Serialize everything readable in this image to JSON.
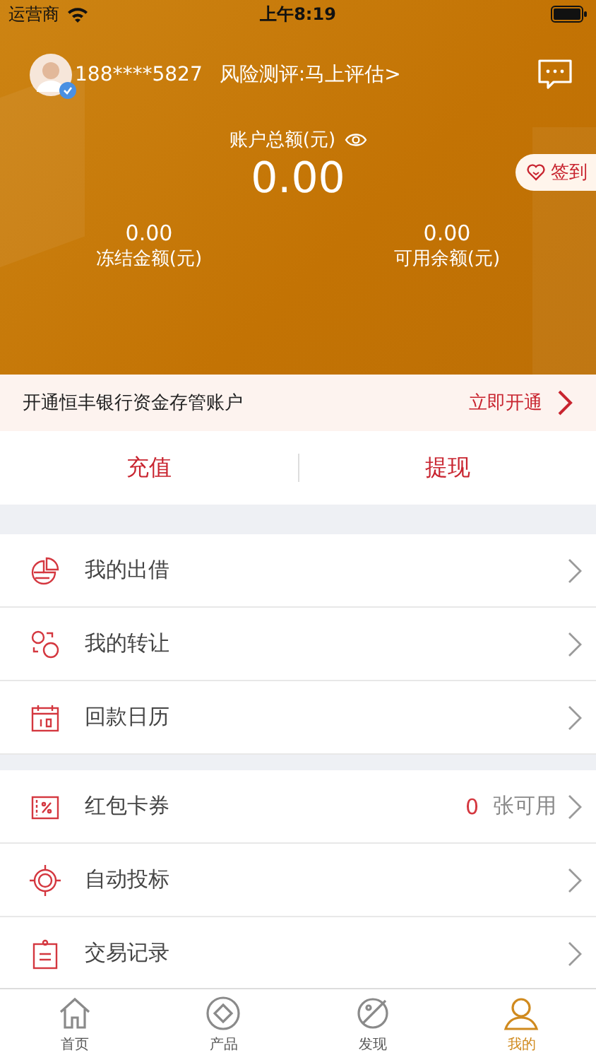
{
  "status_bar": {
    "carrier": "运营商",
    "time": "上午8:19"
  },
  "header": {
    "phone": "188****5827",
    "risk": "风险测评:马上评估>",
    "total_label": "账户总额(元)",
    "total": "0.00",
    "sign_in": "签到",
    "stats": [
      {
        "value": "0.00",
        "label": "冻结金额(元)"
      },
      {
        "value": "0.00",
        "label": "可用余额(元)"
      }
    ]
  },
  "banner": {
    "text": "开通恒丰银行资金存管账户",
    "action": "立即开通"
  },
  "actions": [
    "充值",
    "提现"
  ],
  "menu_groups": [
    [
      {
        "label": "我的出借"
      },
      {
        "label": "我的转让"
      },
      {
        "label": "回款日历"
      }
    ],
    [
      {
        "label": "红包卡券",
        "count": "0",
        "count_suffix": "张可用"
      },
      {
        "label": "自动投标"
      },
      {
        "label": "交易记录"
      }
    ]
  ],
  "tabs": [
    {
      "label": "首页",
      "selected": false
    },
    {
      "label": "产品",
      "selected": false
    },
    {
      "label": "发现",
      "selected": false
    },
    {
      "label": "我的",
      "selected": true
    }
  ]
}
